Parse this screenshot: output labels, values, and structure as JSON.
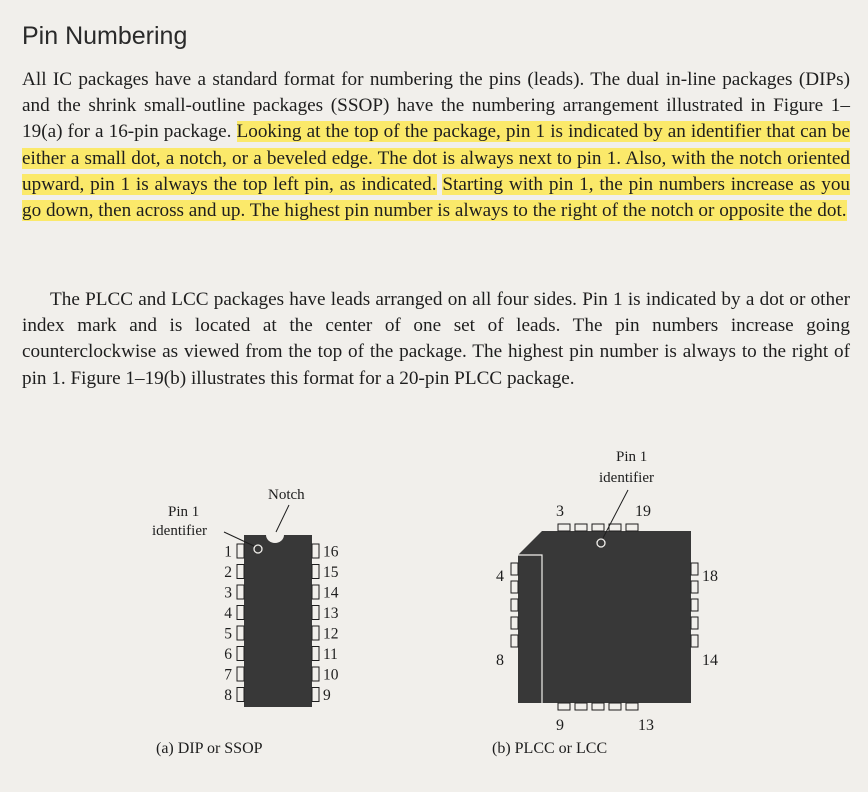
{
  "section": {
    "heading": "Pin Numbering"
  },
  "paragraph1": {
    "plain": "All IC packages have a standard format for numbering the pins (leads). The dual in-line packages (DIPs) and the shrink small-outline packages (SSOP) have the numbering arrangement illustrated in Figure 1–19(a) for a 16-pin package. ",
    "highlight1": "Looking at the top of the package, pin 1 is indicated by an identifier that can be either a small dot, a notch, or a beveled edge. The dot is always next to pin 1. Also, with the notch oriented upward, pin 1 is always the top left pin, as indicated.",
    "gap": " ",
    "highlight2": "Starting with pin 1, the pin numbers increase as you go down, then across and up. The highest pin number is always to the right of the notch or opposite the dot."
  },
  "paragraph2": "The PLCC and LCC packages have leads arranged on all four sides. Pin 1 is indicated by a dot or other index mark and is located at the center of one set of leads. The pin numbers increase going counterclockwise as viewed from the top of the package. The highest pin number is always to the right of pin 1. Figure 1–19(b) illustrates this format for a 20-pin PLCC package.",
  "figure_a": {
    "caption": "(a) DIP or SSOP",
    "notch_label": "Notch",
    "identifier_label_line1": "Pin 1",
    "identifier_label_line2": "identifier",
    "left_pins": [
      "1",
      "2",
      "3",
      "4",
      "5",
      "6",
      "7",
      "8"
    ],
    "right_pins": [
      "16",
      "15",
      "14",
      "13",
      "12",
      "11",
      "10",
      "9"
    ]
  },
  "figure_b": {
    "caption": "(b) PLCC or LCC",
    "identifier_label_line1": "Pin 1",
    "identifier_label_line2": "identifier",
    "pin_top_left": "3",
    "pin_top_right": "19",
    "pin_left_top": "4",
    "pin_left_bottom": "8",
    "pin_right_top": "18",
    "pin_right_bottom": "14",
    "pin_bottom_left": "9",
    "pin_bottom_right": "13"
  },
  "colors": {
    "highlight": "#fbe96a",
    "package_body": "#383838",
    "page": "#f1efeb"
  }
}
